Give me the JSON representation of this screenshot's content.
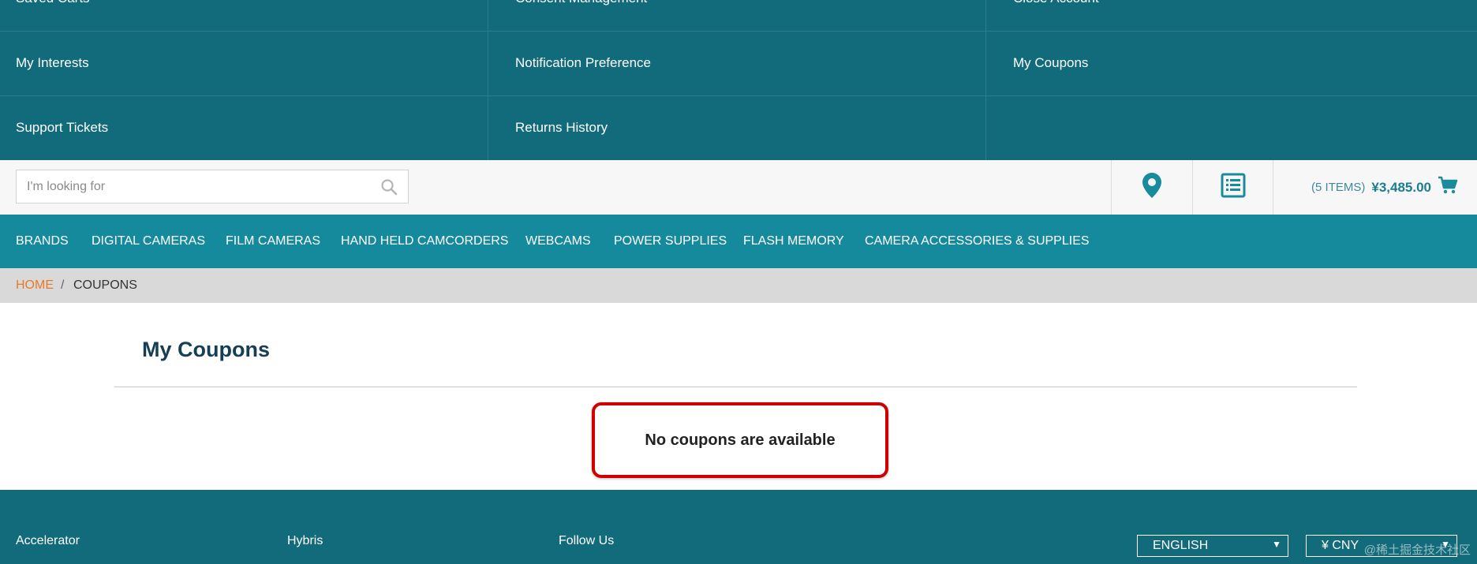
{
  "account_menu": {
    "rows": [
      [
        "Saved Carts",
        "Consent Management",
        "Close Account"
      ],
      [
        "My Interests",
        "Notification Preference",
        "My Coupons"
      ],
      [
        "Support Tickets",
        "Returns History",
        ""
      ]
    ]
  },
  "search": {
    "placeholder": "I'm looking for"
  },
  "toolbar": {
    "store_finder_icon": "map-pin-icon",
    "quick_order_icon": "list-icon",
    "cart_items": "(5 ITEMS)",
    "cart_total": "¥3,485.00",
    "cart_icon": "cart-icon"
  },
  "categories": [
    "BRANDS",
    "DIGITAL CAMERAS",
    "FILM CAMERAS",
    "HAND HELD CAMCORDERS",
    "WEBCAMS",
    "POWER SUPPLIES",
    "FLASH MEMORY",
    "CAMERA ACCESSORIES & SUPPLIES"
  ],
  "breadcrumb": {
    "home": "HOME",
    "separator": "/",
    "current": "COUPONS"
  },
  "main": {
    "title": "My Coupons",
    "empty_message": "No coupons are available"
  },
  "footer": {
    "columns": [
      "Accelerator",
      "Hybris",
      "Follow Us"
    ],
    "language": "ENGLISH",
    "currency": "¥ CNY",
    "watermark": "@稀土掘金技术社区"
  },
  "colors": {
    "account_bg": "#116b7a",
    "nav_bg": "#168a9d",
    "accent_orange": "#e8792c",
    "highlight_red": "#d10000"
  }
}
